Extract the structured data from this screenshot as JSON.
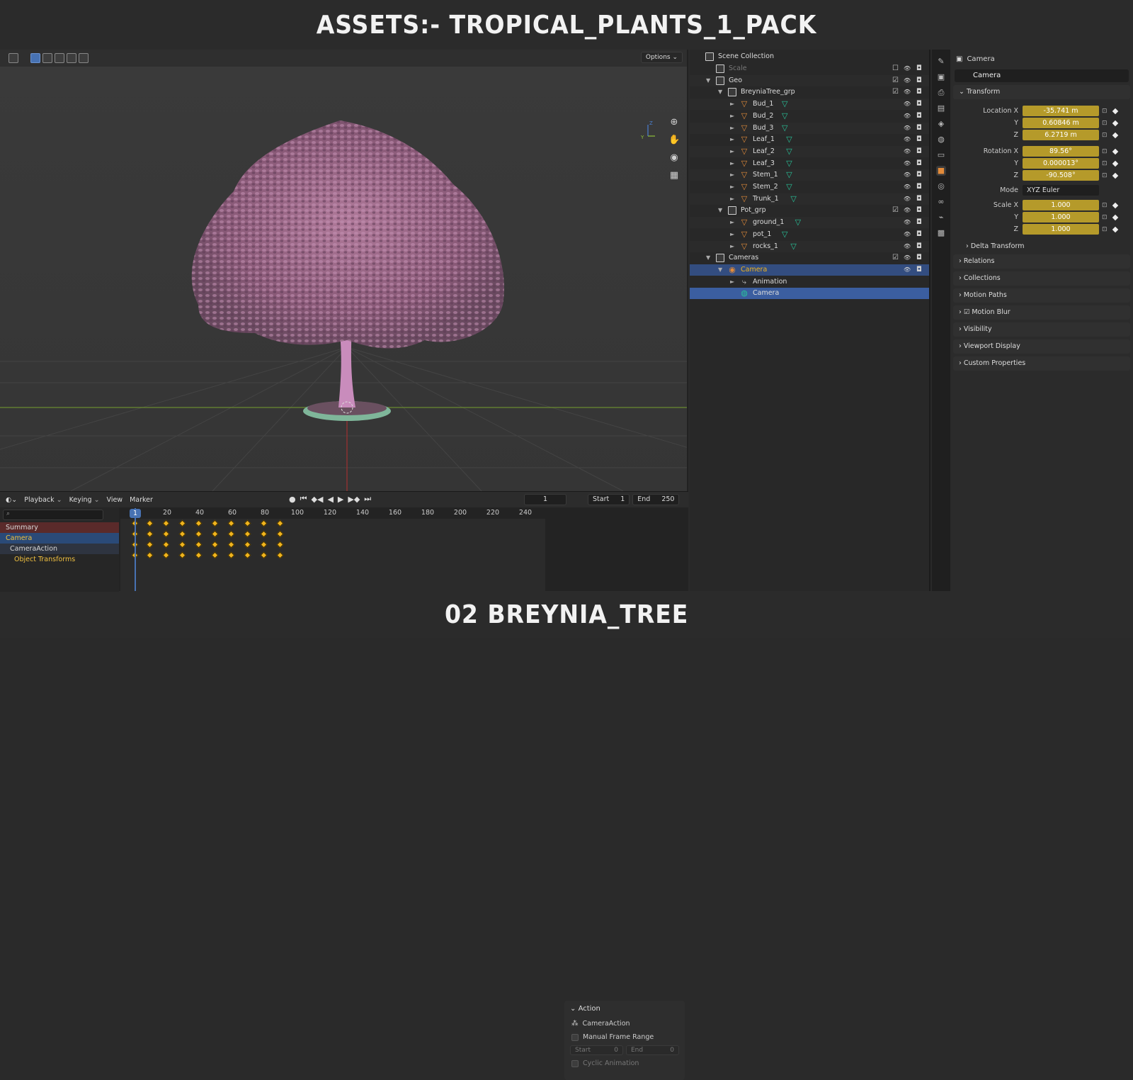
{
  "banner": {
    "top": "ASSETS:- TROPICAL_PLANTS_1_PACK",
    "bottom": "02 BREYNIA_TREE"
  },
  "viewport": {
    "options_label": "Options",
    "gizmo_axes": [
      "Z",
      "Y",
      "X"
    ]
  },
  "timeline": {
    "menu": [
      "Playback",
      "Keying",
      "View",
      "Marker"
    ],
    "current_frame": "1",
    "start_label": "Start",
    "start_value": "1",
    "end_label": "End",
    "end_value": "250",
    "ticks": [
      "1",
      "20",
      "40",
      "60",
      "80",
      "100",
      "120",
      "140",
      "160",
      "180",
      "200",
      "220",
      "240"
    ],
    "channels": {
      "summary": "Summary",
      "camera": "Camera",
      "action": "CameraAction",
      "transforms": "Object Transforms"
    },
    "keyframe_frames": [
      1,
      10,
      20,
      30,
      40,
      50,
      60,
      70,
      80,
      90
    ],
    "action_panel": {
      "title": "Action",
      "action_name": "CameraAction",
      "manual_range": "Manual Frame Range",
      "start_label": "Start",
      "start_value": "0",
      "end_label": "End",
      "end_value": "0",
      "cyclic": "Cyclic Animation"
    }
  },
  "outliner": {
    "scene_collection": "Scene Collection",
    "rows": [
      {
        "label": "Scale",
        "depth": 1,
        "kind": "coll",
        "dim": true
      },
      {
        "label": "Geo",
        "depth": 1,
        "kind": "coll",
        "open": true
      },
      {
        "label": "BreyniaTree_grp",
        "depth": 2,
        "kind": "coll",
        "open": true
      },
      {
        "label": "Bud_1",
        "depth": 3,
        "kind": "mesh"
      },
      {
        "label": "Bud_2",
        "depth": 3,
        "kind": "mesh"
      },
      {
        "label": "Bud_3",
        "depth": 3,
        "kind": "mesh"
      },
      {
        "label": "Leaf_1",
        "depth": 3,
        "kind": "mesh"
      },
      {
        "label": "Leaf_2",
        "depth": 3,
        "kind": "mesh"
      },
      {
        "label": "Leaf_3",
        "depth": 3,
        "kind": "mesh"
      },
      {
        "label": "Stem_1",
        "depth": 3,
        "kind": "mesh"
      },
      {
        "label": "Stem_2",
        "depth": 3,
        "kind": "mesh"
      },
      {
        "label": "Trunk_1",
        "depth": 3,
        "kind": "mesh"
      },
      {
        "label": "Pot_grp",
        "depth": 2,
        "kind": "coll",
        "open": true
      },
      {
        "label": "ground_1",
        "depth": 3,
        "kind": "mesh"
      },
      {
        "label": "pot_1",
        "depth": 3,
        "kind": "mesh"
      },
      {
        "label": "rocks_1",
        "depth": 3,
        "kind": "mesh"
      },
      {
        "label": "Cameras",
        "depth": 1,
        "kind": "coll",
        "open": true
      },
      {
        "label": "Camera",
        "depth": 2,
        "kind": "camera",
        "open": true,
        "selected": true
      },
      {
        "label": "Animation",
        "depth": 3,
        "kind": "anim"
      },
      {
        "label": "Camera",
        "depth": 3,
        "kind": "camdata",
        "active": true
      }
    ]
  },
  "properties": {
    "object_name": "Camera",
    "data_name": "Camera",
    "transform": "Transform",
    "location": {
      "label": "Location X",
      "x": "-35.741 m",
      "y": "0.60846 m",
      "z": "6.2719 m"
    },
    "rotation": {
      "label": "Rotation X",
      "x": "89.56°",
      "y": "0.000013°",
      "z": "-90.508°"
    },
    "mode_label": "Mode",
    "mode_value": "XYZ Euler",
    "scale": {
      "label": "Scale X",
      "x": "1.000",
      "y": "1.000",
      "z": "1.000"
    },
    "axis_y": "Y",
    "axis_z": "Z",
    "delta": "Delta Transform",
    "panels": [
      "Relations",
      "Collections",
      "Motion Paths",
      "Motion Blur",
      "Visibility",
      "Viewport Display",
      "Custom Properties"
    ]
  }
}
